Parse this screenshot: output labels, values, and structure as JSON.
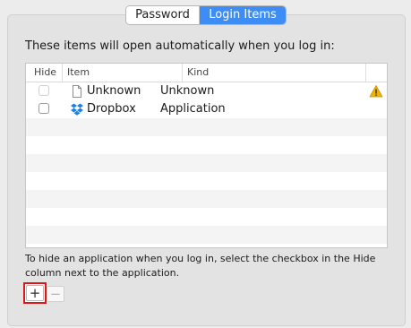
{
  "tabs": [
    {
      "label": "Password",
      "selected": false
    },
    {
      "label": "Login Items",
      "selected": true
    }
  ],
  "heading": "These items will open automatically when you log in:",
  "table": {
    "columns": [
      "Hide",
      "Item",
      "Kind"
    ],
    "rows": [
      {
        "item": "Unknown",
        "kind": "Unknown",
        "hide_checked": false,
        "icon": "document-icon",
        "warning": "warning-icon"
      },
      {
        "item": "Dropbox",
        "kind": "Application",
        "hide_checked": false,
        "icon": "dropbox-icon"
      }
    ]
  },
  "footnote": "To hide an application when you log in, select the checkbox in the Hide column next to the application.",
  "buttons": {
    "add": "+",
    "remove": "−"
  },
  "colors": {
    "accent": "#3d8df5",
    "highlight_border": "#e01616",
    "warning": "#f0b400",
    "dropbox": "#1f81e5"
  }
}
